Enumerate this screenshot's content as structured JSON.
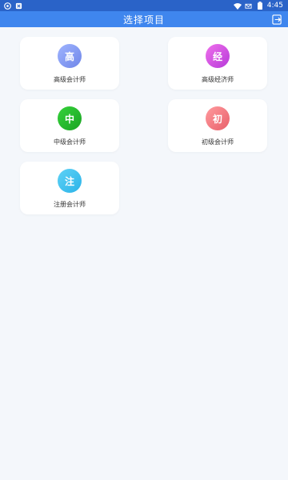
{
  "status_bar": {
    "time": "4:45",
    "icons": [
      "notification-icon",
      "app-icon",
      "wifi-icon",
      "mail-icon",
      "battery-icon"
    ]
  },
  "app_bar": {
    "title": "选择项目",
    "exit_icon": "exit-icon"
  },
  "projects": [
    {
      "badge": "高",
      "label": "高级会计师",
      "color": "#7f96f0"
    },
    {
      "badge": "经",
      "label": "高级经济师",
      "color": "#d24ee2"
    },
    {
      "badge": "中",
      "label": "中级会计师",
      "color": "#22b92a"
    },
    {
      "badge": "初",
      "label": "初级会计师",
      "color": "#f07a80"
    },
    {
      "badge": "注",
      "label": "注册会计师",
      "color": "#3cc0ee"
    }
  ]
}
